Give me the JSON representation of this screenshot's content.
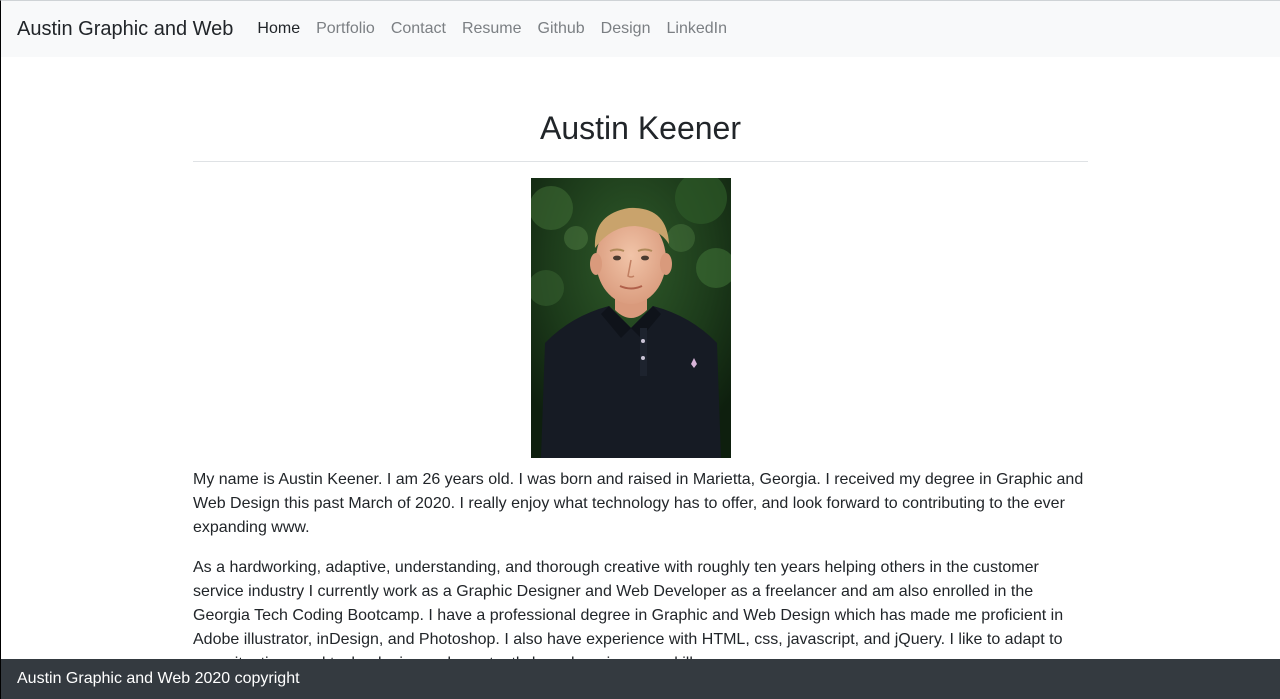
{
  "navbar": {
    "brand": "Austin Graphic and Web",
    "links": [
      {
        "label": "Home",
        "active": true
      },
      {
        "label": "Portfolio",
        "active": false
      },
      {
        "label": "Contact",
        "active": false
      },
      {
        "label": "Resume",
        "active": false
      },
      {
        "label": "Github",
        "active": false
      },
      {
        "label": "Design",
        "active": false
      },
      {
        "label": "LinkedIn",
        "active": false
      }
    ]
  },
  "main": {
    "title": "Austin Keener",
    "photo_icon": "portrait-photo",
    "paragraphs": [
      "My name is Austin Keener. I am 26 years old. I was born and raised in Marietta, Georgia. I received my degree in Graphic and Web Design this past March of 2020. I really enjoy what technology has to offer, and look forward to contributing to the ever expanding www.",
      "As a hardworking, adaptive, understanding, and thorough creative with roughly ten years helping others in the customer service industry I currently work as a Graphic Designer and Web Developer as a freelancer and am also enrolled in the Georgia Tech Coding Bootcamp. I have a professional degree in Graphic and Web Design which has made me proficient in Adobe illustrator, inDesign, and Photoshop. I also have experience with HTML, css, javascript, and jQuery. I like to adapt to new situations and technologies and constantly keep learning new skills."
    ]
  },
  "footer": {
    "text": "Austin Graphic and Web 2020 copyright"
  },
  "colors": {
    "navbar_bg": "#f8f9fa",
    "footer_bg": "#343a40",
    "text": "#212529",
    "nav_muted": "#7b7f83"
  }
}
